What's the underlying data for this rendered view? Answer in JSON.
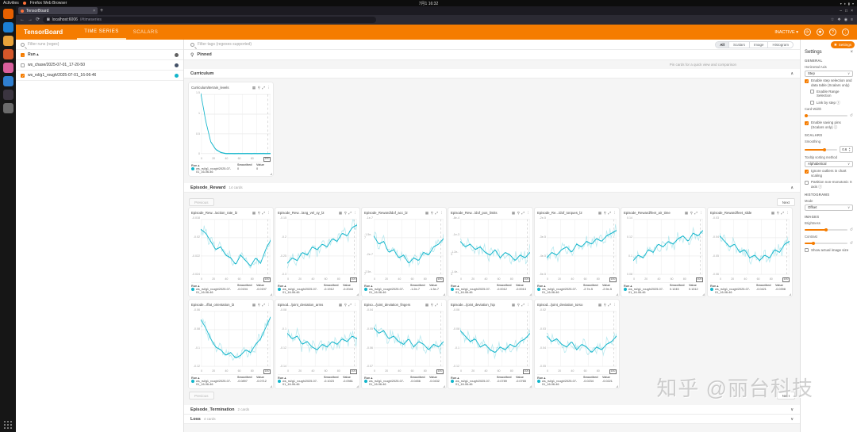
{
  "os": {
    "topbar": {
      "activities": "Activities",
      "app_menu": "Firefox Web Browser",
      "clock": "7月1 16:32"
    },
    "dock": [
      {
        "name": "firefox",
        "color": "#e66000"
      },
      {
        "name": "thunderbird",
        "color": "#1b7fd4"
      },
      {
        "name": "files",
        "color": "#e9a33a"
      },
      {
        "name": "rhythmbox",
        "color": "#d4572a"
      },
      {
        "name": "software",
        "color": "#d85f9c"
      },
      {
        "name": "help",
        "color": "#2f7fd0"
      },
      {
        "name": "terminal",
        "color": "#3b3540"
      },
      {
        "name": "trash",
        "color": "#6b6b6b"
      }
    ]
  },
  "browser": {
    "tab_title": "TensorBoard",
    "new_tab": "+",
    "url_host": "localhost:6006",
    "url_path": "/#timeseries",
    "window_controls": [
      "–",
      "□",
      "×"
    ]
  },
  "header": {
    "logo": "TensorBoard",
    "tabs": [
      {
        "label": "TIME SERIES",
        "active": true
      },
      {
        "label": "SCALARS",
        "active": false
      }
    ],
    "status": "INACTIVE",
    "icons": [
      "refresh-icon",
      "gear-icon",
      "help-icon",
      "more-icon"
    ]
  },
  "sidebar": {
    "filter_placeholder": "Filter runs (regex)",
    "column_header": "Run",
    "runs": [
      {
        "name": "ws_chase/2025-07-01_17-20-50",
        "checked": false,
        "color": "#425066"
      },
      {
        "name": "ws_rsl/g1_rough/2025-07-01_16-06-46",
        "checked": true,
        "color": "#12b5cb"
      }
    ]
  },
  "toolbar": {
    "filter_placeholder": "Filter tags (regexes supported)",
    "filters": [
      "All",
      "Scalars",
      "Image",
      "Histogram"
    ],
    "active_filter": "All",
    "settings_button": "Settings"
  },
  "pinned": {
    "label": "Pinned",
    "hint": "Pin cards for a quick view and comparison"
  },
  "pagination": {
    "previous": "Previous",
    "next": "Next"
  },
  "sections": {
    "curriculum": {
      "title": "Curriculum"
    },
    "episode_reward": {
      "title": "Episode_Reward",
      "count": "14 cards"
    },
    "episode_termination": {
      "title": "Episode_Termination",
      "count": "2 cards"
    },
    "loss": {
      "title": "Loss",
      "count": "4 cards"
    }
  },
  "card_common": {
    "footer_headers": {
      "run": "Run ▴",
      "smoothed": "Smoothed",
      "value": "Value"
    },
    "run_label": "ws_rsl/g1_rough/2025-07-01_16-06-46",
    "xticks": [
      "0",
      "20",
      "40",
      "60",
      "80"
    ],
    "xtick_boxed": "100",
    "line_color": "#12b5cb",
    "icons": [
      "data-table-icon",
      "pin-icon",
      "fullscreen-icon",
      "more-icon"
    ]
  },
  "chart_data": [
    {
      "type": "line",
      "id": "curriculum",
      "title": "Curriculum/terrain_levels",
      "x_range": [
        0,
        100
      ],
      "yticks": [
        "1.5",
        "1",
        "0.5",
        "0"
      ],
      "smoothed": "0",
      "value": "0",
      "amp": 0.008,
      "seed": 99,
      "trend": [
        1.02,
        0.55,
        0.2,
        0.07,
        0.02,
        0,
        0,
        0,
        0,
        0,
        0,
        0,
        0,
        0,
        0
      ]
    },
    {
      "type": "line",
      "row": 1,
      "title": "Episode_Rew.../action_rate_l2",
      "x_range": [
        0,
        100
      ],
      "yticks": [
        "-0.018",
        "-0.02",
        "-0.022",
        "-0.024"
      ],
      "smoothed": "-0.0194",
      "value": "-0.0197",
      "amp": 0.2,
      "seed": 1,
      "trend": [
        0.82,
        0.75,
        0.6,
        0.45,
        0.5,
        0.35,
        0.3,
        0.18,
        0.35,
        0.25,
        0.15,
        0.3,
        0.2,
        0.45,
        0.62
      ]
    },
    {
      "type": "line",
      "row": 1,
      "title": "Episode_Rew.../ang_vel_xy_l2",
      "x_range": [
        0,
        100
      ],
      "yticks": [
        "-0.15",
        "-0.2",
        "-0.25",
        "-0.3"
      ],
      "smoothed": "-0.1912",
      "value": "-0.2044",
      "amp": 0.2,
      "seed": 2,
      "trend": [
        0.2,
        0.3,
        0.25,
        0.4,
        0.35,
        0.5,
        0.45,
        0.55,
        0.5,
        0.65,
        0.6,
        0.75,
        0.7,
        0.85,
        0.9
      ]
    },
    {
      "type": "line",
      "row": 1,
      "title": "Episode_Reward/dof_acc_l2",
      "x_range": [
        0,
        100
      ],
      "yticks": [
        "-1e-7",
        "-1.5e-7",
        "-2e-7",
        "-2.5e-7"
      ],
      "smoothed": "-1.2e-7",
      "value": "-1.3e-7",
      "amp": 0.2,
      "seed": 3,
      "trend": [
        0.7,
        0.55,
        0.6,
        0.4,
        0.45,
        0.3,
        0.35,
        0.2,
        0.3,
        0.25,
        0.4,
        0.35,
        0.5,
        0.55,
        0.65
      ]
    },
    {
      "type": "line",
      "row": 1,
      "title": "Episode_Rew.../dof_pos_limits",
      "x_range": [
        0,
        100
      ],
      "yticks": [
        "-8e-4",
        "-1e-3",
        "-1.2e-3",
        "-1.4e-3"
      ],
      "smoothed": "-0.0012",
      "value": "-0.0013",
      "amp": 0.22,
      "seed": 4,
      "trend": [
        0.6,
        0.5,
        0.55,
        0.45,
        0.5,
        0.4,
        0.35,
        0.45,
        0.3,
        0.4,
        0.35,
        0.25,
        0.35,
        0.3,
        0.4
      ]
    },
    {
      "type": "line",
      "row": 1,
      "title": "Episode_Re.../dof_torques_l2",
      "x_range": [
        0,
        100
      ],
      "yticks": [
        "-2e-5",
        "-3e-5",
        "-4e-5",
        "-5e-5"
      ],
      "smoothed": "-2.7e-5",
      "value": "-2.9e-5",
      "amp": 0.2,
      "seed": 5,
      "trend": [
        0.3,
        0.4,
        0.35,
        0.45,
        0.5,
        0.4,
        0.55,
        0.5,
        0.6,
        0.55,
        0.65,
        0.6,
        0.7,
        0.75,
        0.8
      ]
    },
    {
      "type": "line",
      "row": 1,
      "title": "Episode_Reward/feet_air_time",
      "x_range": [
        0,
        100
      ],
      "yticks": [
        "0.14",
        "0.12",
        "0.1",
        "0.08"
      ],
      "smoothed": "0.1245",
      "value": "0.1312",
      "amp": 0.2,
      "seed": 6,
      "trend": [
        0.25,
        0.35,
        0.3,
        0.45,
        0.4,
        0.55,
        0.5,
        0.6,
        0.55,
        0.65,
        0.7,
        0.6,
        0.75,
        0.7,
        0.8
      ]
    },
    {
      "type": "line",
      "row": 1,
      "title": "Episode_Reward/feet_slide",
      "x_range": [
        0,
        100
      ],
      "yticks": [
        "-0.03",
        "-0.04",
        "-0.05",
        "-0.06"
      ],
      "smoothed": "-0.0421",
      "value": "-0.0398",
      "amp": 0.2,
      "seed": 7,
      "trend": [
        0.7,
        0.6,
        0.5,
        0.55,
        0.4,
        0.45,
        0.3,
        0.35,
        0.25,
        0.35,
        0.3,
        0.45,
        0.4,
        0.55,
        0.6
      ]
    },
    {
      "type": "line",
      "row": 2,
      "title": "Episode.../flat_orientation_l2",
      "x_range": [
        0,
        100
      ],
      "yticks": [
        "-0.06",
        "-0.08",
        "-0.1",
        "-0.12"
      ],
      "smoothed": "-0.0897",
      "value": "-0.0712",
      "amp": 0.18,
      "seed": 8,
      "trend": [
        0.85,
        0.7,
        0.5,
        0.35,
        0.3,
        0.2,
        0.25,
        0.15,
        0.2,
        0.3,
        0.25,
        0.4,
        0.5,
        0.7,
        0.9
      ]
    },
    {
      "type": "line",
      "row": 2,
      "title": "Episod.../joint_deviation_arms",
      "x_range": [
        0,
        100
      ],
      "yticks": [
        "-0.08",
        "-0.1",
        "-0.12",
        "-0.14"
      ],
      "smoothed": "-0.1023",
      "value": "-0.0981",
      "amp": 0.22,
      "seed": 9,
      "trend": [
        0.6,
        0.5,
        0.55,
        0.4,
        0.45,
        0.35,
        0.3,
        0.4,
        0.35,
        0.45,
        0.4,
        0.5,
        0.45,
        0.55,
        0.5
      ]
    },
    {
      "type": "line",
      "row": 2,
      "title": "Episo.../joint_deviation_fingers",
      "x_range": [
        0,
        100
      ],
      "yticks": [
        "-0.04",
        "-0.05",
        "-0.06",
        "-0.07"
      ],
      "smoothed": "-0.0456",
      "value": "-0.0432",
      "amp": 0.22,
      "seed": 10,
      "trend": [
        0.7,
        0.6,
        0.65,
        0.5,
        0.55,
        0.45,
        0.4,
        0.5,
        0.35,
        0.45,
        0.4,
        0.3,
        0.4,
        0.35,
        0.45
      ]
    },
    {
      "type": "line",
      "row": 2,
      "title": "Episode.../joint_deviation_hip",
      "x_range": [
        0,
        100
      ],
      "yticks": [
        "-0.06",
        "-0.08",
        "-0.1",
        "-0.12"
      ],
      "smoothed": "-0.0789",
      "value": "-0.0765",
      "amp": 0.2,
      "seed": 11,
      "trend": [
        0.65,
        0.55,
        0.45,
        0.5,
        0.35,
        0.4,
        0.3,
        0.25,
        0.35,
        0.3,
        0.4,
        0.35,
        0.45,
        0.5,
        0.6
      ]
    },
    {
      "type": "line",
      "row": 2,
      "title": "Episod.../joint_deviation_torso",
      "x_range": [
        0,
        100
      ],
      "yticks": [
        "-0.02",
        "-0.03",
        "-0.04",
        "-0.05"
      ],
      "smoothed": "-0.0234",
      "value": "-0.0221",
      "amp": 0.2,
      "seed": 12,
      "trend": [
        0.55,
        0.45,
        0.5,
        0.4,
        0.35,
        0.45,
        0.3,
        0.4,
        0.35,
        0.25,
        0.35,
        0.3,
        0.4,
        0.45,
        0.55
      ]
    }
  ],
  "settings_panel": {
    "title": "Settings",
    "close": "×",
    "items": [
      {
        "t": "section",
        "label": "GENERAL"
      },
      {
        "t": "label",
        "label": "Horizontal Axis"
      },
      {
        "t": "select",
        "value": "Step",
        "name": "horizontal-axis-select"
      },
      {
        "t": "check",
        "checked": true,
        "label": "Enable step selection and data table (Scalars only)"
      },
      {
        "t": "check",
        "checked": false,
        "indent": true,
        "label": "Enable Range Selection"
      },
      {
        "t": "check",
        "checked": false,
        "indent": true,
        "label": "Link by step ⓘ"
      },
      {
        "t": "label",
        "label": "Card Width"
      },
      {
        "t": "slider",
        "pos": 0.04,
        "reset": true,
        "name": "card-width-slider"
      },
      {
        "t": "check",
        "checked": true,
        "label": "Enable saving pins (Scalars only) ⓘ"
      },
      {
        "t": "section",
        "label": "SCALARS"
      },
      {
        "t": "label",
        "label": "Smoothing"
      },
      {
        "t": "slider",
        "pos": 0.6,
        "input": "0.6",
        "name": "smoothing-slider"
      },
      {
        "t": "label",
        "label": "Tooltip sorting method"
      },
      {
        "t": "select",
        "value": "Alphabetical",
        "name": "tooltip-sort-select"
      },
      {
        "t": "check",
        "checked": true,
        "label": "Ignore outliers in chart scaling"
      },
      {
        "t": "check",
        "checked": false,
        "label": "Partition non-monotonic X axis ⓘ"
      },
      {
        "t": "section",
        "label": "HISTOGRAMS"
      },
      {
        "t": "label",
        "label": "Mode"
      },
      {
        "t": "select",
        "value": "Offset",
        "name": "histogram-mode-select"
      },
      {
        "t": "section",
        "label": "IMAGES"
      },
      {
        "t": "label",
        "label": "Brightness"
      },
      {
        "t": "slider",
        "pos": 0.5,
        "reset": true,
        "name": "brightness-slider"
      },
      {
        "t": "label",
        "label": "Contrast"
      },
      {
        "t": "slider",
        "pos": 0.2,
        "reset": true,
        "name": "contrast-slider"
      },
      {
        "t": "check",
        "checked": false,
        "label": "Show actual image size"
      }
    ]
  },
  "watermark": "知乎 @丽台科技"
}
